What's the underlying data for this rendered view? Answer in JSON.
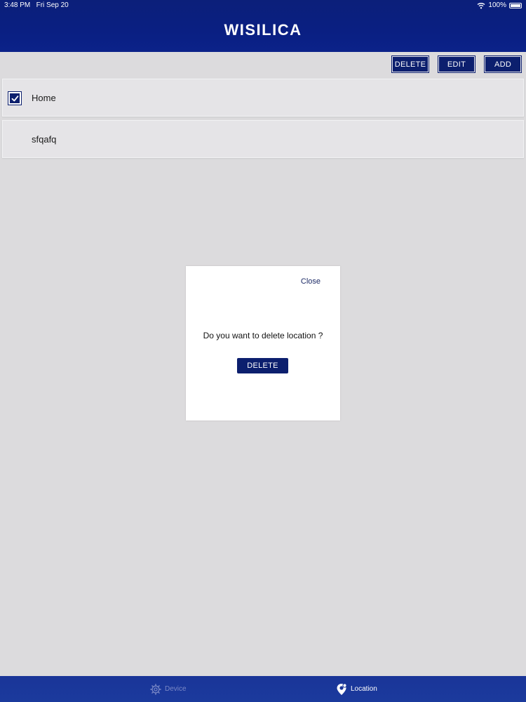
{
  "status_bar": {
    "time": "3:48 PM",
    "date": "Fri Sep 20",
    "battery": "100%"
  },
  "header": {
    "brand": "WISILICA"
  },
  "toolbar": {
    "delete_label": "DELETE",
    "edit_label": "EDIT",
    "add_label": "ADD"
  },
  "locations": [
    {
      "name": "Home",
      "checked": true
    },
    {
      "name": "sfqafq",
      "checked": false
    }
  ],
  "dialog": {
    "close_label": "Close",
    "message": "Do you want to delete location ?",
    "delete_label": "DELETE"
  },
  "tabbar": {
    "device": {
      "label": "Device",
      "icon": "gear-icon"
    },
    "location": {
      "label": "Location",
      "icon": "location-pin-icon"
    }
  },
  "colors": {
    "brand_navy": "#0c1f6e",
    "header_bg": "#0a1f82",
    "tabbar_bg": "#1a3598",
    "page_bg": "#dcdbdd"
  }
}
